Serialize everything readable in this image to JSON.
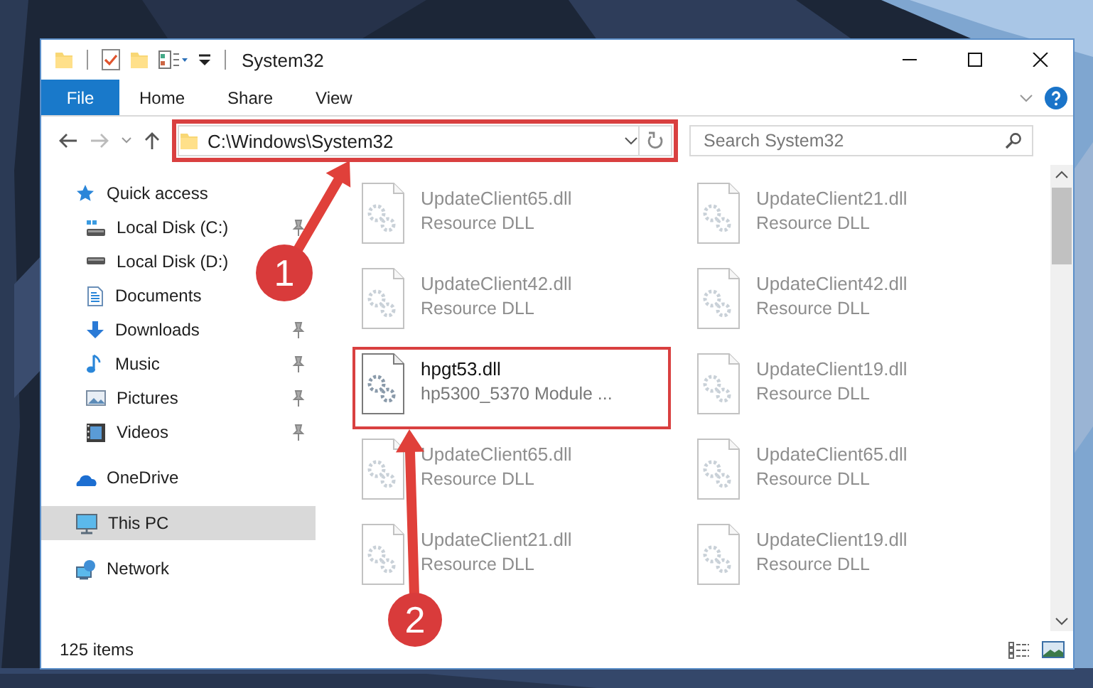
{
  "window": {
    "title": "System32"
  },
  "ribbon": {
    "tabs": [
      {
        "label": "File",
        "kind": "file"
      },
      {
        "label": "Home",
        "kind": "tab"
      },
      {
        "label": "Share",
        "kind": "tab"
      },
      {
        "label": "View",
        "kind": "tab"
      }
    ]
  },
  "address": {
    "path": "C:\\Windows\\System32",
    "highlighted": true
  },
  "search": {
    "placeholder": "Search System32"
  },
  "nav": {
    "items": [
      {
        "label": "Quick access",
        "kind": "star",
        "selected": false,
        "children": [
          {
            "label": "Local Disk (C:)",
            "kind": "drive-c",
            "pinned": true
          },
          {
            "label": "Local Disk (D:)",
            "kind": "drive",
            "pinned": false
          },
          {
            "label": "Documents",
            "kind": "documents",
            "pinned": false
          },
          {
            "label": "Downloads",
            "kind": "downloads",
            "pinned": true
          },
          {
            "label": "Music",
            "kind": "music",
            "pinned": true
          },
          {
            "label": "Pictures",
            "kind": "pictures",
            "pinned": true
          },
          {
            "label": "Videos",
            "kind": "videos",
            "pinned": true
          }
        ]
      },
      {
        "label": "OneDrive",
        "kind": "cloud",
        "selected": false
      },
      {
        "label": "This PC",
        "kind": "computer",
        "selected": true
      },
      {
        "label": "Network",
        "kind": "network",
        "selected": false
      }
    ]
  },
  "files": [
    {
      "name": "UpdateClient65.dll",
      "description": "Resource DLL",
      "faded": true,
      "highlighted": false
    },
    {
      "name": "UpdateClient21.dll",
      "description": "Resource DLL",
      "faded": true,
      "highlighted": false
    },
    {
      "name": "UpdateClient42.dll",
      "description": "Resource DLL",
      "faded": true,
      "highlighted": false
    },
    {
      "name": "UpdateClient42.dll",
      "description": "Resource DLL",
      "faded": true,
      "highlighted": false
    },
    {
      "name": "hpgt53.dll",
      "description": "hp5300_5370 Module ...",
      "faded": false,
      "highlighted": true
    },
    {
      "name": "UpdateClient19.dll",
      "description": "Resource DLL",
      "faded": true,
      "highlighted": false
    },
    {
      "name": "UpdateClient65.dll",
      "description": "Resource DLL",
      "faded": true,
      "highlighted": false
    },
    {
      "name": "UpdateClient65.dll",
      "description": "Resource DLL",
      "faded": true,
      "highlighted": false
    },
    {
      "name": "UpdateClient21.dll",
      "description": "Resource DLL",
      "faded": true,
      "highlighted": false
    },
    {
      "name": "UpdateClient19.dll",
      "description": "Resource DLL",
      "faded": true,
      "highlighted": false
    }
  ],
  "status_bar": {
    "item_count": "125 items"
  },
  "annotations": [
    {
      "label": "1"
    },
    {
      "label": "2"
    }
  ]
}
